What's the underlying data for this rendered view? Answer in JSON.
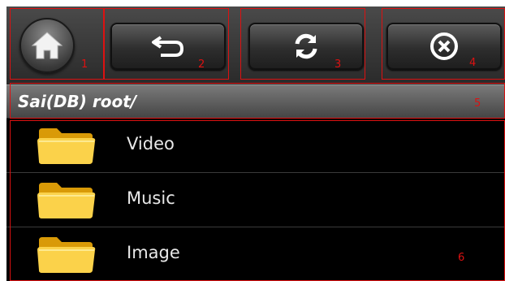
{
  "toolbar": {
    "buttons": [
      {
        "name": "home-button",
        "icon": "home-icon",
        "marker": "1"
      },
      {
        "name": "back-button",
        "icon": "back-arrow-icon",
        "marker": "2"
      },
      {
        "name": "refresh-button",
        "icon": "refresh-icon",
        "marker": "3"
      },
      {
        "name": "close-button",
        "icon": "close-circle-icon",
        "marker": "4"
      }
    ]
  },
  "path_bar": {
    "path": "Sai(DB) root/",
    "marker": "5"
  },
  "file_list": {
    "items": [
      {
        "label": "Video",
        "icon": "folder-icon"
      },
      {
        "label": "Music",
        "icon": "folder-icon"
      },
      {
        "label": "Image",
        "icon": "folder-icon"
      }
    ],
    "marker": "6"
  },
  "colors": {
    "annotation": "#dd1111",
    "folder": "#f7c21a",
    "background": "#000000"
  }
}
